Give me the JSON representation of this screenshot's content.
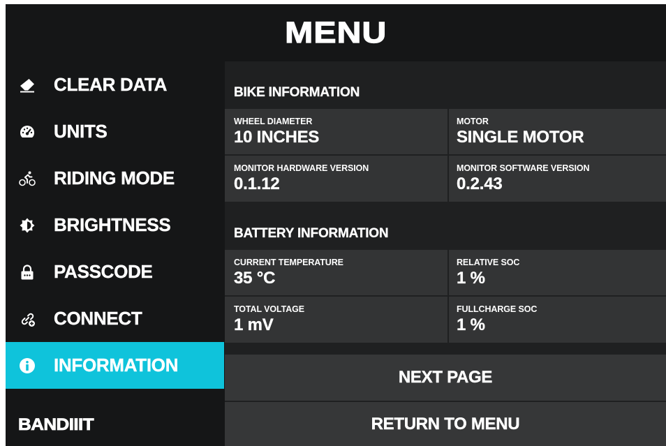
{
  "header": {
    "title": "MENU"
  },
  "sidebar": {
    "items": [
      {
        "label": "CLEAR DATA",
        "icon": "eraser-icon"
      },
      {
        "label": "UNITS",
        "icon": "speedometer-icon"
      },
      {
        "label": "RIDING MODE",
        "icon": "cyclist-icon"
      },
      {
        "label": "BRIGHTNESS",
        "icon": "brightness-icon"
      },
      {
        "label": "PASSCODE",
        "icon": "lock-icon"
      },
      {
        "label": "CONNECT",
        "icon": "link-add-icon"
      },
      {
        "label": "INFORMATION",
        "icon": "info-icon",
        "active": true
      }
    ],
    "brand": "BANDIIIT"
  },
  "bike_info": {
    "title": "BIKE INFORMATION",
    "wheel_diameter": {
      "label": "WHEEL DIAMETER",
      "value": "10 INCHES"
    },
    "motor": {
      "label": "MOTOR",
      "value": "SINGLE MOTOR"
    },
    "hw_version": {
      "label": "MONITOR HARDWARE VERSION",
      "value": "0.1.12"
    },
    "sw_version": {
      "label": "MONITOR SOFTWARE VERSION",
      "value": "0.2.43"
    }
  },
  "battery_info": {
    "title": "BATTERY INFORMATION",
    "temperature": {
      "label": "CURRENT TEMPERATURE",
      "value": "35 °C"
    },
    "relative_soc": {
      "label": "RELATIVE SOC",
      "value": "1 %"
    },
    "voltage": {
      "label": "TOTAL VOLTAGE",
      "value": "1 mV"
    },
    "fullcharge_soc": {
      "label": "FULLCHARGE SOC",
      "value": "1 %"
    }
  },
  "actions": {
    "next_page": "NEXT PAGE",
    "return_to_menu": "RETURN TO MENU"
  },
  "colors": {
    "accent": "#0fc3db",
    "background": "#151617",
    "panel": "#1f2021",
    "cell": "#333435"
  }
}
